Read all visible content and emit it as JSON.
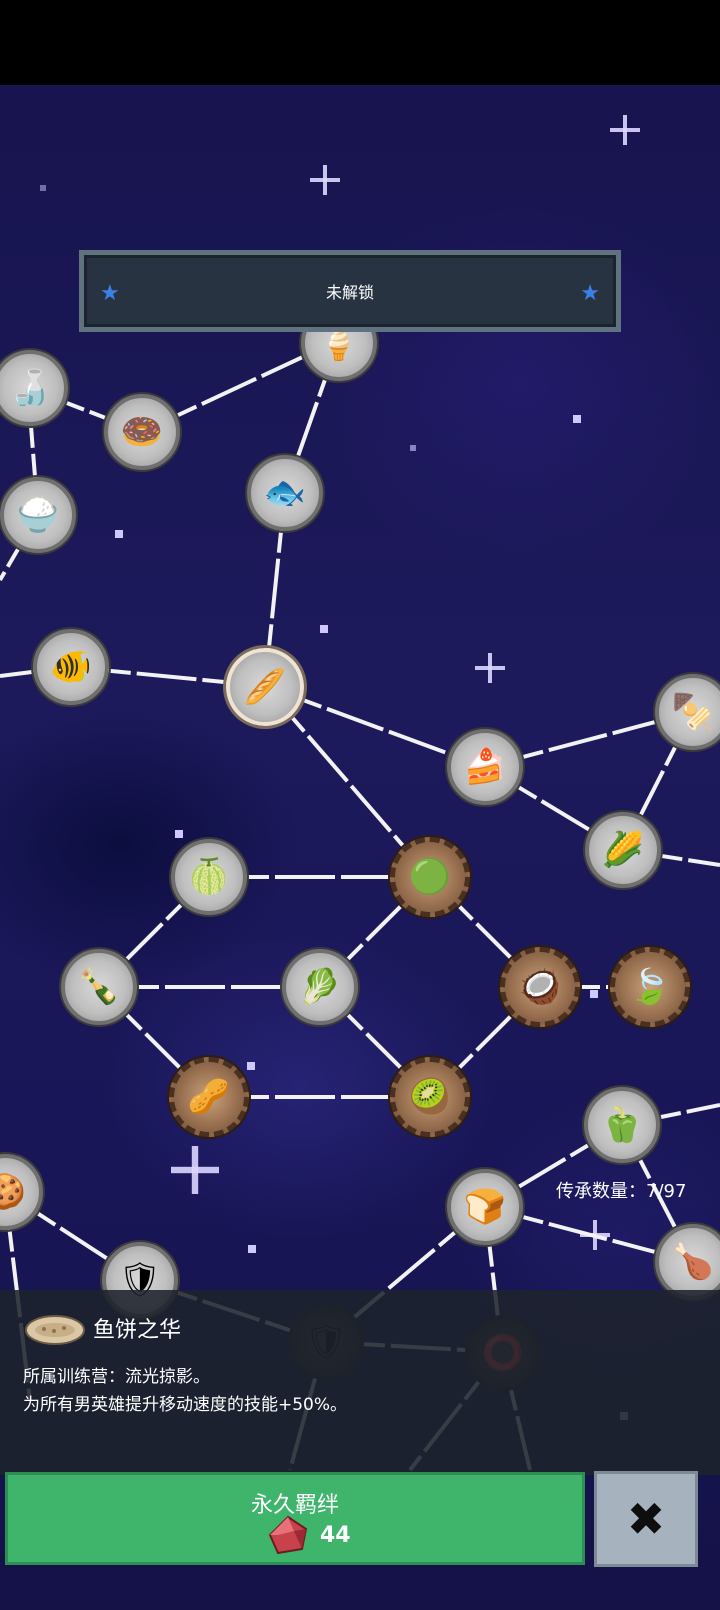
{
  "banner": {
    "title": "未解锁"
  },
  "progress": {
    "label": "传承数量：7/97"
  },
  "selected_talent": {
    "name": "鱼饼之华",
    "camp_line": "所属训练营：流光掠影。",
    "effect_line": "为所有男英雄提升移动速度的技能+50%。"
  },
  "bond_button": {
    "label": "永久羁绊",
    "cost": "44"
  },
  "close_button": {
    "icon": "close-icon"
  },
  "colors": {
    "button_green": "#3fb46b",
    "banner_bg": "#283341",
    "accent_star": "#3d7fe6"
  }
}
